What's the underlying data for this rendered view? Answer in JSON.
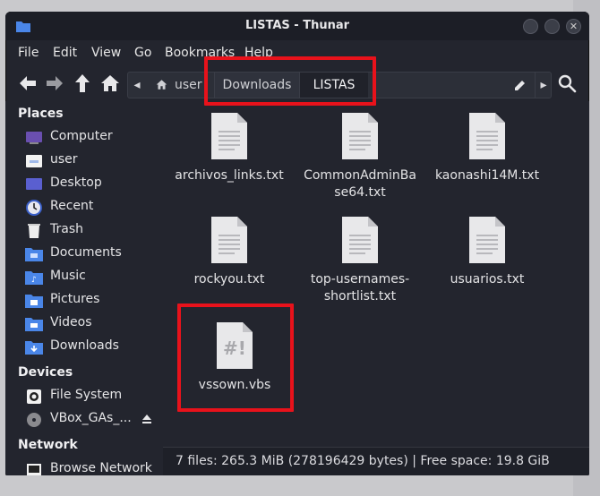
{
  "window": {
    "title": "LISTAS - Thunar"
  },
  "menu": {
    "file": "File",
    "edit": "Edit",
    "view": "View",
    "go": "Go",
    "bookmarks": "Bookmarks",
    "help": "Help"
  },
  "path": {
    "home": "user",
    "segments": [
      "Downloads",
      "LISTAS"
    ]
  },
  "sidebar": {
    "places_header": "Places",
    "places": [
      "Computer",
      "user",
      "Desktop",
      "Recent",
      "Trash",
      "Documents",
      "Music",
      "Pictures",
      "Videos",
      "Downloads"
    ],
    "devices_header": "Devices",
    "devices": [
      "File System",
      "VBox_GAs_..."
    ],
    "network_header": "Network",
    "network": [
      "Browse Network"
    ]
  },
  "files": [
    {
      "name": "archivos_links.txt",
      "icon": "text-file-icon"
    },
    {
      "name": "CommonAdminBase64.txt",
      "icon": "text-file-icon"
    },
    {
      "name": "kaonashi14M.txt",
      "icon": "text-file-icon"
    },
    {
      "name": "rockyou.txt",
      "icon": "text-file-icon"
    },
    {
      "name": "top-usernames-shortlist.txt",
      "icon": "text-file-icon"
    },
    {
      "name": "usuarios.txt",
      "icon": "text-file-icon"
    },
    {
      "name": "vssown.vbs",
      "icon": "script-file-icon"
    }
  ],
  "status": "7 files: 265.3 MiB (278196429 bytes) | Free space: 19.8 GiB",
  "colors": {
    "highlight": "#e8121b",
    "folder": "#4a86e8",
    "window_bg": "#23252e"
  }
}
